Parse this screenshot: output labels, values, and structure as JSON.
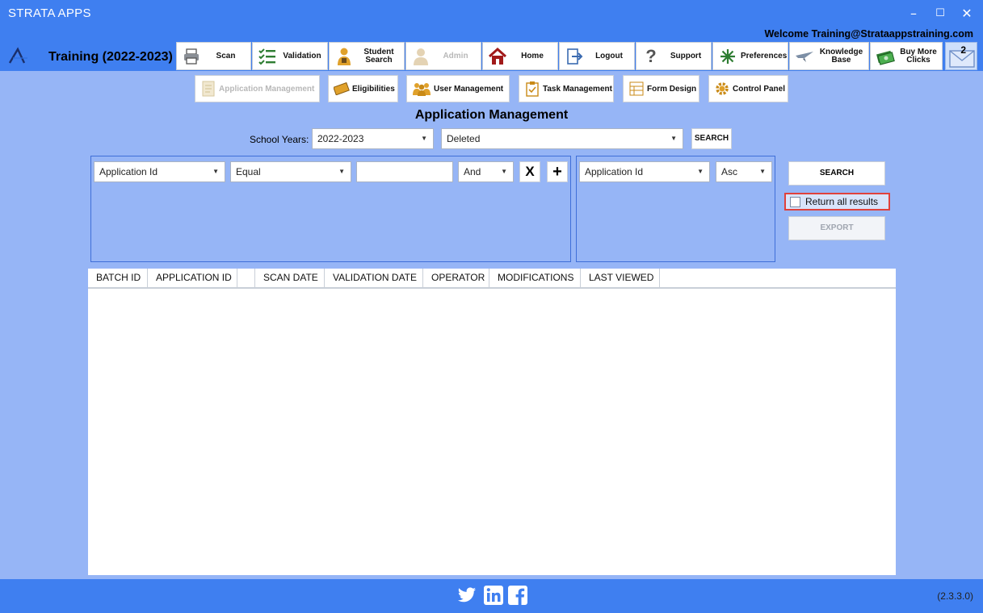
{
  "window": {
    "title": "STRATA APPS",
    "welcome": "Welcome Training@Strataappstraining.com",
    "training_label": "Training (2022-2023)",
    "controls": {
      "minimize": "–",
      "maximize": "☐",
      "close": "✕"
    }
  },
  "nav": [
    {
      "label": "Scan",
      "icon": "printer-icon"
    },
    {
      "label": "Validation",
      "icon": "checklist-icon"
    },
    {
      "label": "Student Search",
      "icon": "student-icon"
    },
    {
      "label": "Admin",
      "icon": "admin-icon",
      "disabled": true
    },
    {
      "label": "Home",
      "icon": "home-icon"
    },
    {
      "label": "Logout",
      "icon": "logout-icon"
    },
    {
      "label": "Support",
      "icon": "question-icon"
    },
    {
      "label": "Preferences",
      "icon": "preferences-icon"
    },
    {
      "label": "Knowledge Base",
      "icon": "plane-icon"
    },
    {
      "label": "Buy More Clicks",
      "icon": "money-icon"
    }
  ],
  "mail": {
    "count": "2"
  },
  "subnav": [
    {
      "label": "Application Management",
      "disabled": true
    },
    {
      "label": "Eligibilities"
    },
    {
      "label": "User Management"
    },
    {
      "label": "Task Management"
    },
    {
      "label": "Form Design"
    },
    {
      "label": "Control Panel"
    }
  ],
  "page": {
    "title": "Application Management",
    "school_years_label": "School Years:",
    "school_year_value": "2022-2023",
    "status_value": "Deleted",
    "top_search_label": "SEARCH"
  },
  "filter": {
    "field": "Application Id",
    "operator": "Equal",
    "value": "",
    "conjunction": "And",
    "remove_label": "X",
    "add_label": "+"
  },
  "sort": {
    "field": "Application Id",
    "direction": "Asc"
  },
  "actions": {
    "search_label": "SEARCH",
    "return_all_label": "Return all results",
    "return_all_checked": false,
    "export_label": "EXPORT"
  },
  "grid": {
    "columns": [
      "BATCH ID",
      "APPLICATION ID",
      "",
      "SCAN DATE",
      "VALIDATION DATE",
      "OPERATOR",
      "MODIFICATIONS",
      "LAST VIEWED"
    ]
  },
  "footer": {
    "social": [
      "twitter-icon",
      "linkedin-icon",
      "facebook-icon"
    ],
    "version": "(2.3.3.0)"
  }
}
